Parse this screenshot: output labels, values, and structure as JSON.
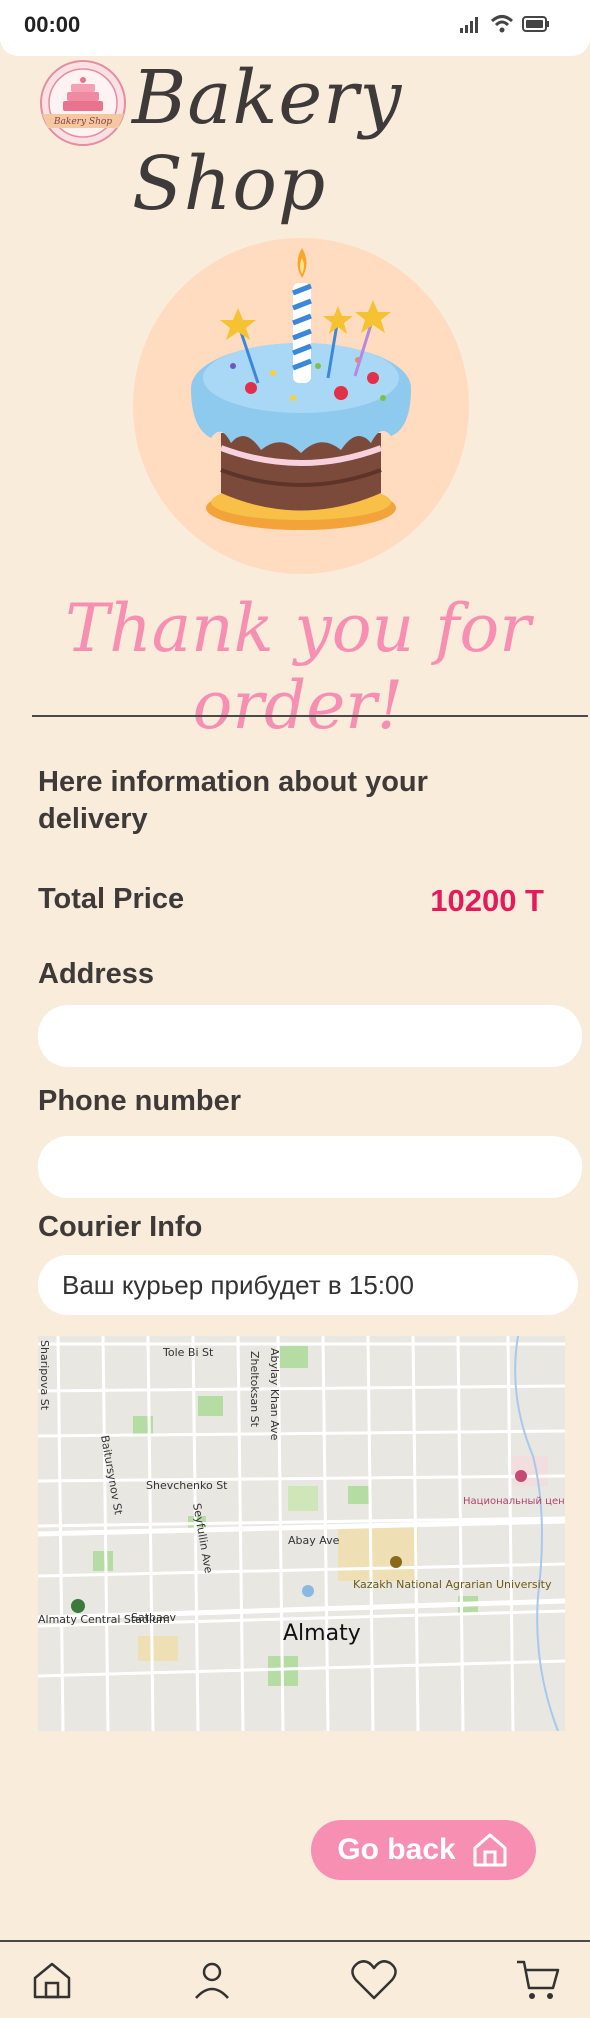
{
  "status_bar": {
    "time": "00:00",
    "icons": [
      "signal-icon",
      "wifi-icon",
      "battery-icon"
    ]
  },
  "header": {
    "logo_title": "Bakery Shop",
    "badge_text": "Bakery Shop"
  },
  "hero": {
    "thanks_text": "Thank you for order!"
  },
  "delivery": {
    "title": "Here information about your delivery",
    "total_price_label": "Total Price",
    "total_price_value": "10200 T",
    "address_label": "Address",
    "address_value": "",
    "phone_label": "Phone number",
    "phone_value": "",
    "courier_label": "Courier Info",
    "courier_message": "Ваш курьер прибудет в 15:00"
  },
  "map": {
    "city": "Almaty",
    "streets": [
      "Tole Bi St",
      "Zheltoksan St",
      "Abylay Khan Ave",
      "Baitursynov St",
      "Shevchenko St",
      "Seyfullin Ave",
      "Abay Ave",
      "Satbaev",
      "Sharipova St"
    ],
    "places": [
      "Kazakh National Agrarian University",
      "Almaty Central Stadium",
      "Национальный центр проблем туберкулеза"
    ]
  },
  "actions": {
    "go_back_label": "Go back"
  },
  "bottom_nav": {
    "items": [
      "home-icon",
      "profile-icon",
      "favorites-icon",
      "cart-icon"
    ]
  },
  "colors": {
    "background": "#f9ecdb",
    "accent_pink": "#f78fb3",
    "price_red": "#e41a5d",
    "text_dark": "#3f3a3a"
  }
}
